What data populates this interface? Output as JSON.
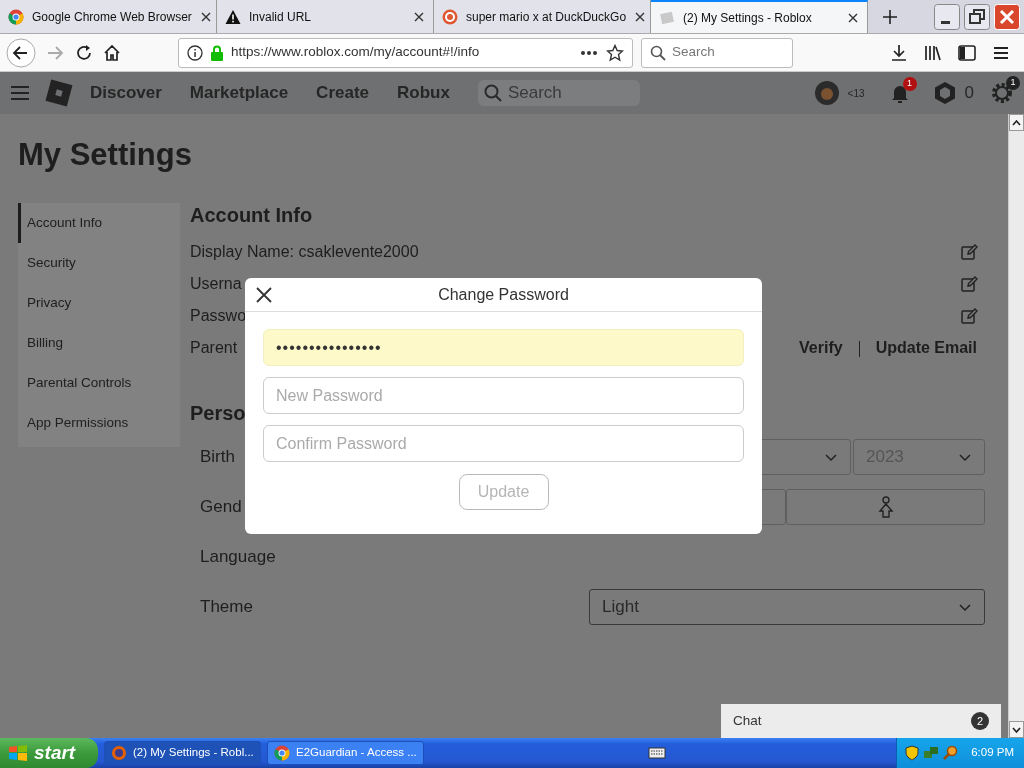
{
  "browser": {
    "tabs": [
      {
        "title": "Google Chrome Web Browser",
        "selected": false,
        "kind": "chrome"
      },
      {
        "title": "Invalid URL",
        "selected": false,
        "kind": "warning"
      },
      {
        "title": "super mario x at DuckDuckGo",
        "selected": false,
        "kind": "duck"
      },
      {
        "title": "(2) My Settings - Roblox",
        "selected": true,
        "kind": "page"
      }
    ],
    "url": "https://www.roblox.com/my/account#!/info",
    "search_placeholder": "Search"
  },
  "site_nav": {
    "links": [
      "Discover",
      "Marketplace",
      "Create",
      "Robux"
    ],
    "search_placeholder": "Search",
    "age_label": "<13",
    "notifications_badge": "1",
    "robux_balance": "0",
    "settings_badge": "1"
  },
  "page": {
    "title": "My Settings",
    "sidebar": [
      {
        "label": "Account Info",
        "selected": true
      },
      {
        "label": "Security",
        "selected": false
      },
      {
        "label": "Privacy",
        "selected": false
      },
      {
        "label": "Billing",
        "selected": false
      },
      {
        "label": "Parental Controls",
        "selected": false
      },
      {
        "label": "App Permissions",
        "selected": false
      }
    ],
    "account_info": {
      "heading": "Account Info",
      "rows": [
        {
          "label": "Display Name: csaklevente2000",
          "kind": "edit"
        },
        {
          "label": "Userna",
          "kind": "edit"
        },
        {
          "label": "Passwo",
          "kind": "edit"
        },
        {
          "label": "Parent",
          "kind": "links",
          "actions": [
            "Verify",
            "Update Email"
          ]
        }
      ]
    },
    "personal": {
      "heading": "Perso",
      "rows": [
        {
          "label": "Birth",
          "kind": "date",
          "year": "2023"
        },
        {
          "label": "Gend",
          "kind": "gender"
        },
        {
          "label": "Language",
          "kind": "none"
        },
        {
          "label": "Theme",
          "kind": "select",
          "value": "Light"
        }
      ]
    }
  },
  "modal": {
    "title": "Change Password",
    "fields": [
      {
        "value": "••••••••••••••••",
        "autofilled": true
      },
      {
        "placeholder": "New Password",
        "autofilled": false
      },
      {
        "placeholder": "Confirm Password",
        "autofilled": false
      }
    ],
    "button": {
      "label": "Update",
      "disabled": true
    }
  },
  "chat": {
    "label": "Chat",
    "badge": "2"
  },
  "taskbar": {
    "start": "start",
    "windows": [
      {
        "title": "(2) My Settings - Robl...",
        "selected": true,
        "kind": "firefox"
      },
      {
        "title": "E2Guardian - Access ...",
        "selected": false,
        "kind": "chrome"
      }
    ],
    "clock": "6:09 PM"
  }
}
